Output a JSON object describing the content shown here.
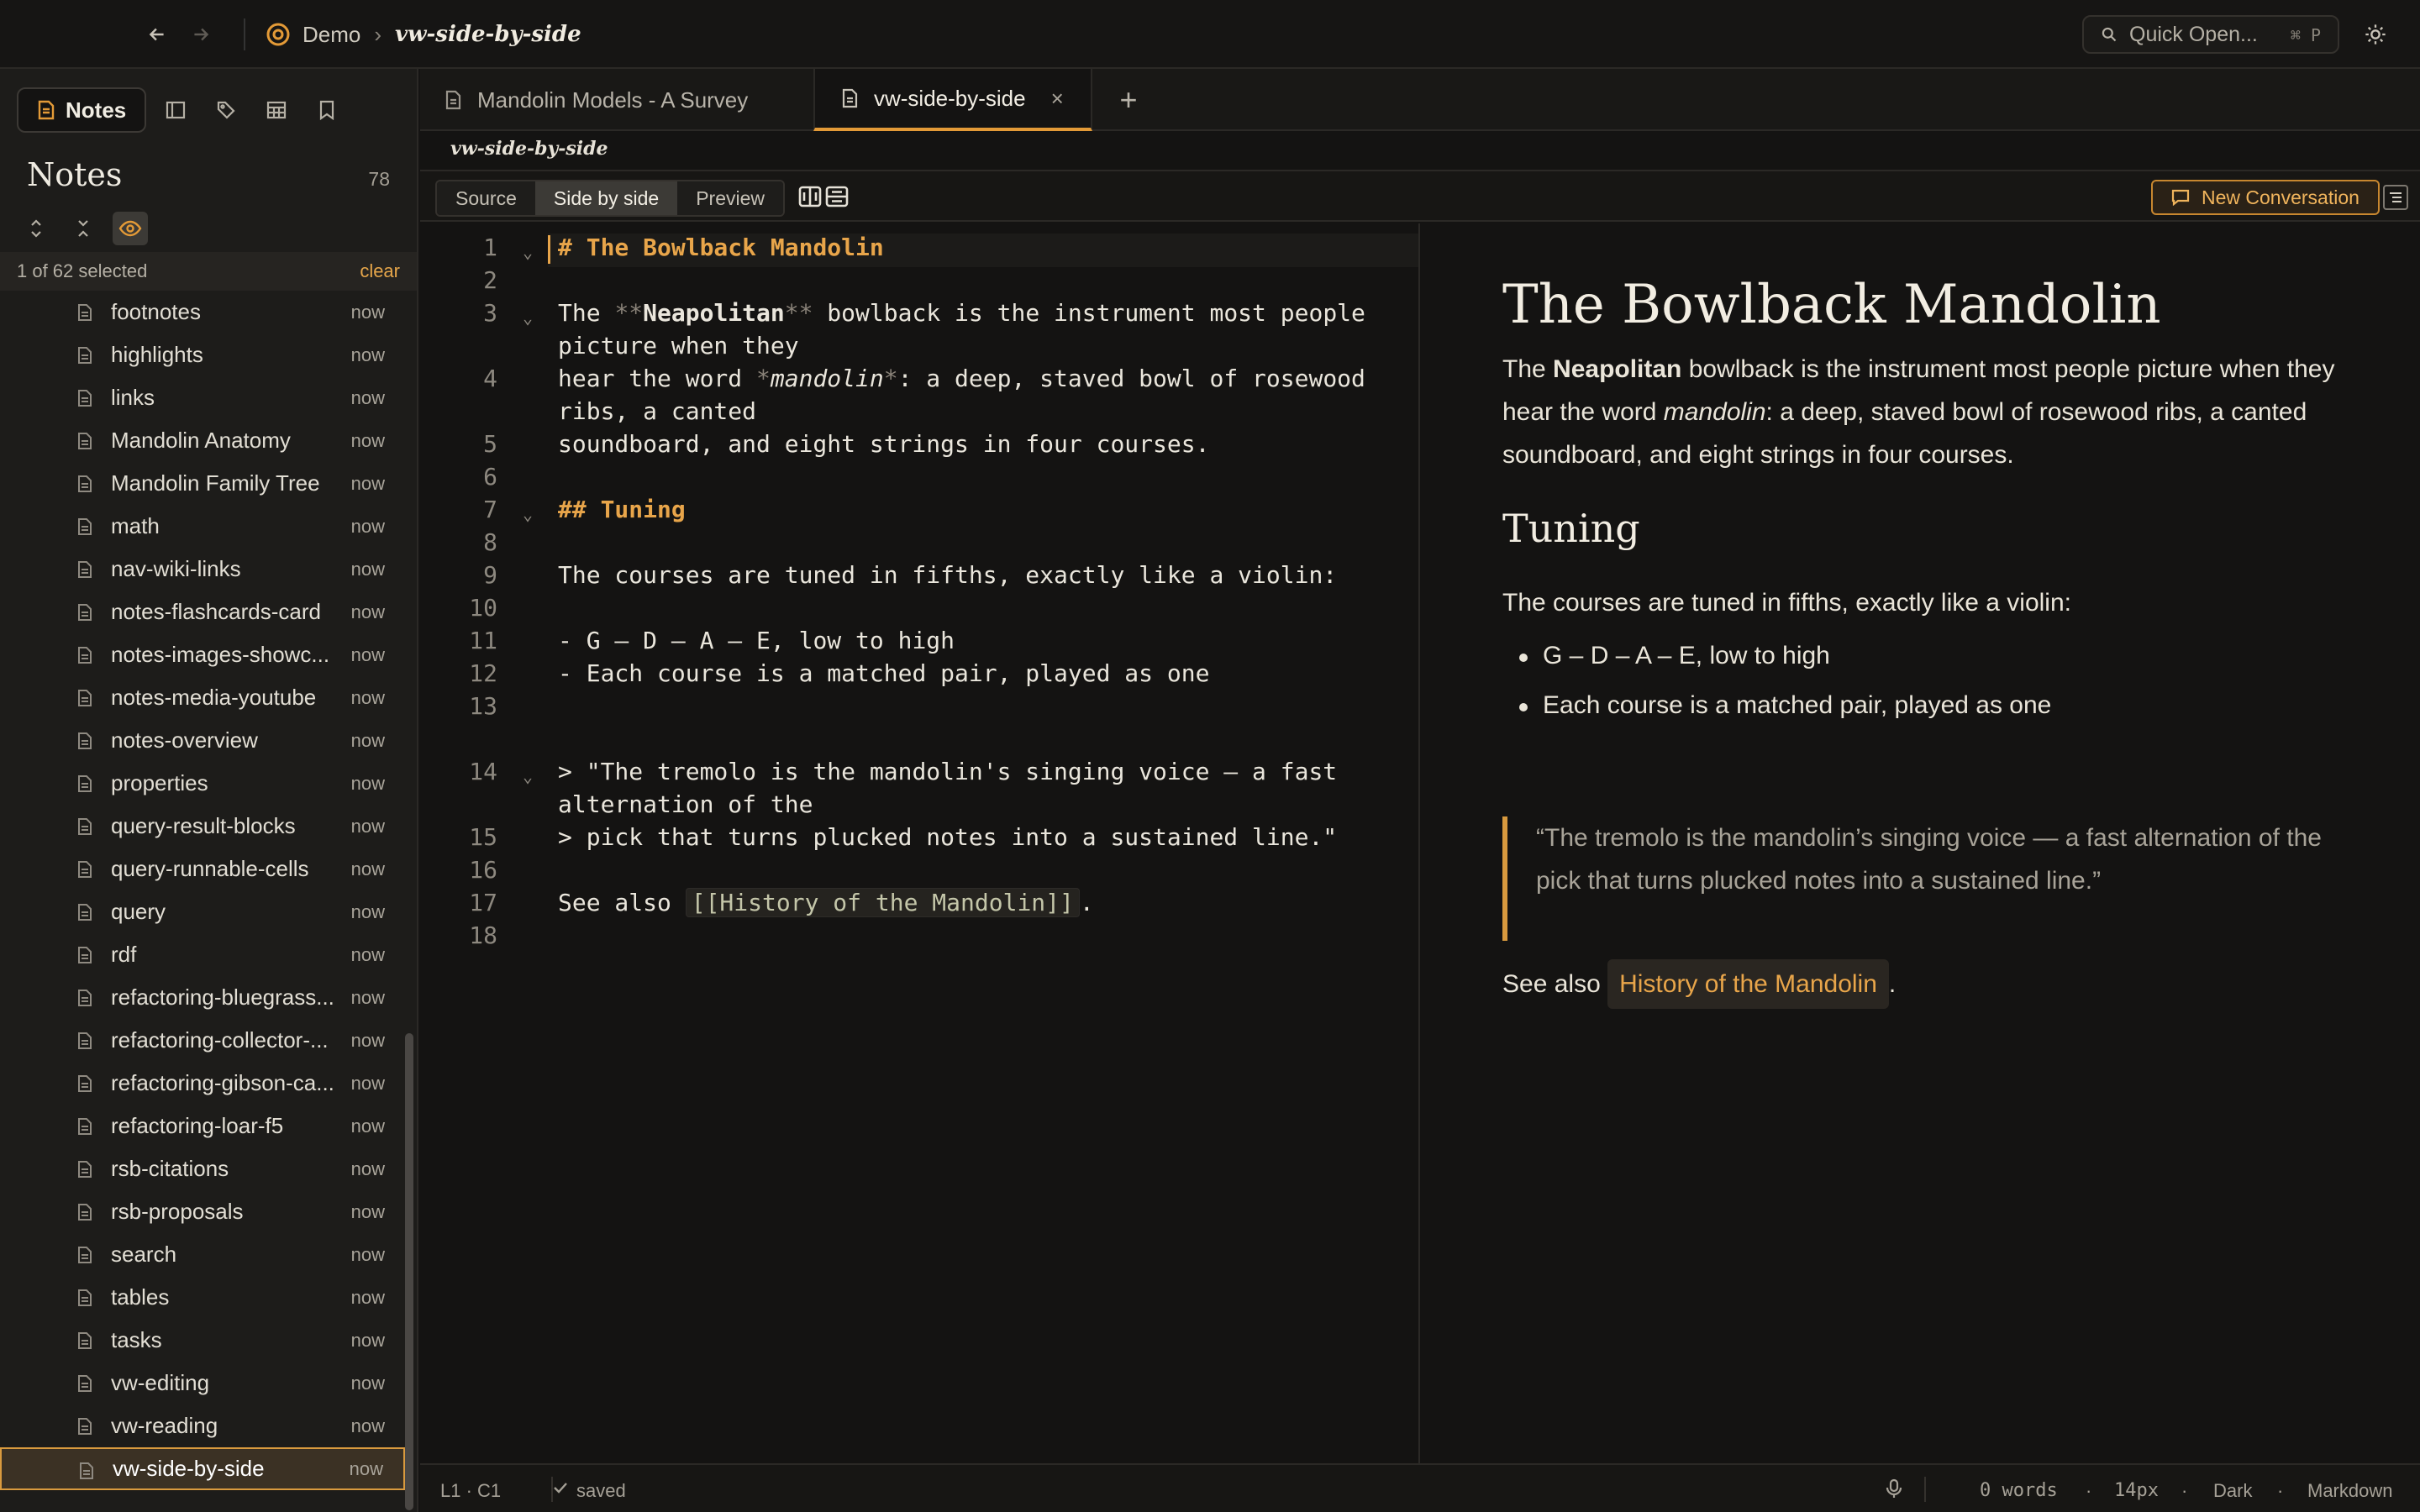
{
  "breadcrumb": {
    "workspace": "Demo",
    "sep": "›",
    "current": "vw-side-by-side"
  },
  "quick_open": {
    "label": "Quick Open...",
    "shortcut": "⌘ P"
  },
  "sidebar": {
    "tab_label": "Notes",
    "title": "Notes",
    "count": "78",
    "selection": {
      "text": "1 of 62 selected",
      "clear": "clear"
    },
    "items": [
      {
        "label": "footnotes",
        "time": "now"
      },
      {
        "label": "highlights",
        "time": "now"
      },
      {
        "label": "links",
        "time": "now"
      },
      {
        "label": "Mandolin Anatomy",
        "time": "now"
      },
      {
        "label": "Mandolin Family Tree",
        "time": "now"
      },
      {
        "label": "math",
        "time": "now"
      },
      {
        "label": "nav-wiki-links",
        "time": "now"
      },
      {
        "label": "notes-flashcards-card",
        "time": "now"
      },
      {
        "label": "notes-images-showc...",
        "time": "now"
      },
      {
        "label": "notes-media-youtube",
        "time": "now"
      },
      {
        "label": "notes-overview",
        "time": "now"
      },
      {
        "label": "properties",
        "time": "now"
      },
      {
        "label": "query-result-blocks",
        "time": "now"
      },
      {
        "label": "query-runnable-cells",
        "time": "now"
      },
      {
        "label": "query",
        "time": "now"
      },
      {
        "label": "rdf",
        "time": "now"
      },
      {
        "label": "refactoring-bluegrass...",
        "time": "now"
      },
      {
        "label": "refactoring-collector-...",
        "time": "now"
      },
      {
        "label": "refactoring-gibson-ca...",
        "time": "now"
      },
      {
        "label": "refactoring-loar-f5",
        "time": "now"
      },
      {
        "label": "rsb-citations",
        "time": "now"
      },
      {
        "label": "rsb-proposals",
        "time": "now"
      },
      {
        "label": "search",
        "time": "now"
      },
      {
        "label": "tables",
        "time": "now"
      },
      {
        "label": "tasks",
        "time": "now"
      },
      {
        "label": "vw-editing",
        "time": "now"
      },
      {
        "label": "vw-reading",
        "time": "now"
      },
      {
        "label": "vw-side-by-side",
        "time": "now",
        "active": true
      }
    ]
  },
  "tabs": [
    {
      "label": "Mandolin Models - A Survey",
      "active": false
    },
    {
      "label": "vw-side-by-side",
      "active": true,
      "close": "×"
    }
  ],
  "add_tab": "+",
  "doc_path": "vw-side-by-side",
  "modes": {
    "source": "Source",
    "side_by_side": "Side by side",
    "preview": "Preview",
    "selected": "Side by side"
  },
  "new_conversation": "New Conversation",
  "editor": {
    "line_numbers": [
      "1",
      "2",
      "3",
      "4",
      "5",
      "6",
      "7",
      "8",
      "9",
      "10",
      "11",
      "12",
      "13",
      "14",
      "15",
      "16",
      "17",
      "18"
    ],
    "line1": {
      "mark": "#",
      "text": "The Bowlback Mandolin"
    },
    "line3": {
      "pre": "The ",
      "mk1": "**",
      "bold": "Neapolitan",
      "mk2": "**",
      "post": " bowlback is the instrument most people",
      "wrap": "picture when they"
    },
    "line4": {
      "pre": "hear the word ",
      "mk1": "*",
      "ital": "mandolin",
      "mk2": "*",
      "post": ": a deep, staved bowl of rosewood",
      "wrap": "ribs, a canted"
    },
    "line5": "soundboard, and eight strings in four courses.",
    "line7": {
      "mark": "##",
      "text": "Tuning"
    },
    "line9": "The courses are tuned in fifths, exactly like a violin:",
    "line11": {
      "mark": "-",
      "text": "G – D – A – E, low to high"
    },
    "line12": {
      "mark": "-",
      "text": "Each course is a matched pair, played as one"
    },
    "line14": {
      "mark": ">",
      "text": "\"The tremolo is the mandolin's singing voice — a fast",
      "wrap": "alternation of the"
    },
    "line15": {
      "mark": ">",
      "text": "pick that turns plucked notes into a sustained line.\""
    },
    "line17": {
      "pre": "See also ",
      "link": "[[History of the Mandolin]]",
      "post": "."
    }
  },
  "preview": {
    "h1": "The Bowlback Mandolin",
    "p1": {
      "pre": "The ",
      "bold": "Neapolitan",
      "mid": " bowlback is the instrument most people picture when they hear the word ",
      "ital": "mandolin",
      "post": ": a deep, staved bowl of rosewood ribs, a canted soundboard, and eight strings in four courses."
    },
    "h2": "Tuning",
    "p2": "The courses are tuned in fifths, exactly like a violin:",
    "bullets": [
      "G – D – A – E, low to high",
      "Each course is a matched pair, played as one"
    ],
    "quote": "“The tremolo is the mandolin’s singing voice — a fast alternation of the pick that turns plucked notes into a sustained line.”",
    "see_also": {
      "pre": "See also ",
      "link": "History of the Mandolin",
      "post": "."
    }
  },
  "status": {
    "position": "L1 · C1",
    "saved": "saved",
    "words": "0 words",
    "font_size": "14px",
    "theme": "Dark",
    "language": "Markdown",
    "dot": "·"
  },
  "colors": {
    "accent": "#e39a37",
    "background": "#141312",
    "sidebar": "#1d1c1a"
  }
}
